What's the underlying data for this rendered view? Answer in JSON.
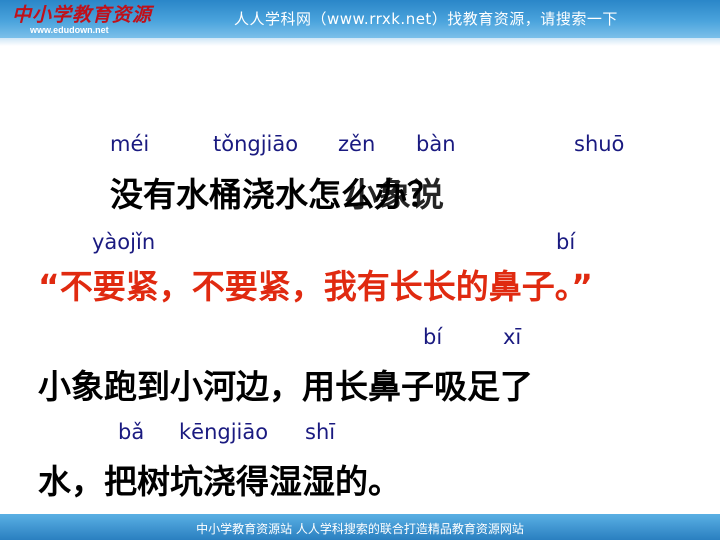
{
  "header": {
    "logo_text": "中小学教育资源",
    "logo_url": "www.edudown.net",
    "tagline": "人人学科网（www.rrxk.net）找教育资源，请搜索一下"
  },
  "pinyin_row_1": [
    "méi",
    "tǒngjiāo",
    "zěn",
    "bàn",
    "shuō"
  ],
  "line_1": "没有水桶浇水怎么办？",
  "line_1_overlap": "小象说",
  "pinyin_row_2": [
    "yàojǐn",
    "bí"
  ],
  "line_2": "“不要紧，不要紧，我有长长的鼻子。”",
  "pinyin_row_3": [
    "bí",
    "xī"
  ],
  "line_3": "小象跑到小河边，用长鼻子吸足了",
  "pinyin_row_4": [
    "bǎ",
    "kēngjiāo",
    "shī"
  ],
  "line_4": "水，把树坑浇得湿湿的。",
  "footer": {
    "text": "中小学教育资源站  人人学科搜索的联合打造精品教育资源网站"
  },
  "colors": {
    "header_blue": "#2a86c8",
    "pinyin": "#1a1a80",
    "quote_red": "#e02a10",
    "body_text": "#000000"
  }
}
